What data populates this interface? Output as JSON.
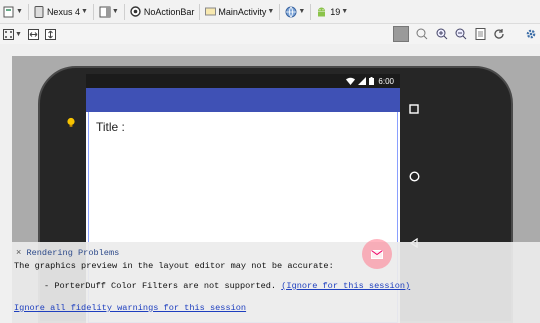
{
  "toolbar": {
    "device": "Nexus 4",
    "theme": "NoActionBar",
    "activity": "MainActivity",
    "api_level": "19"
  },
  "device_screen": {
    "time": "6:00",
    "title_label": "Title :"
  },
  "rendering_problems": {
    "heading": "Rendering Problems",
    "message": "The graphics preview in the layout editor may not be accurate:",
    "item": "- PorterDuff Color Filters are not supported.",
    "ignore_session_link": "(Ignore for this session)",
    "ignore_all_link": "Ignore all fidelity warnings for this session"
  },
  "colors": {
    "app_bar": "#3f51b5",
    "fab": "#ff788c",
    "link": "#1e3fbf"
  }
}
